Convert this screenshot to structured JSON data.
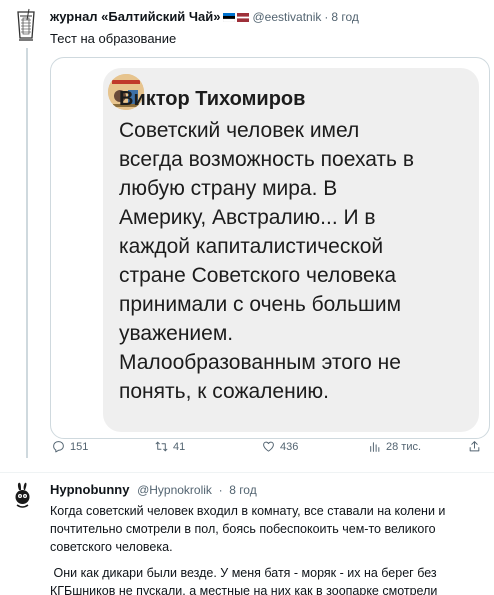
{
  "tweet1": {
    "author_name": "журнал «Балтийский Чай»",
    "handle": "@eestivatnik",
    "separator": "·",
    "time": "8 год",
    "text": "Тест на образование",
    "quote": {
      "author": "Виктор Тихомиров",
      "lines": [
        "Советский человек имел",
        "всегда возможность поехать в",
        "любую страну мира. В",
        "Америку, Австралию... И в",
        "каждой капиталистической",
        "стране Советского человека",
        "принимали с очень большим",
        "уважением.",
        "Малообразованным этого не",
        "понять, к сожалению."
      ]
    },
    "actions": {
      "replies": "151",
      "retweets": "41",
      "likes": "436",
      "views": "28 тис."
    }
  },
  "tweet2": {
    "author_name": "Hypnobunny",
    "handle": "@Hypnokrolik",
    "separator": "·",
    "time": "8 год",
    "paragraph1": "Когда советский человек входил в комнату, все ставали на колени и почтительно смотрели в пол, боясь побеспокоить чем-то великого советского человека.",
    "paragraph2": " Они как дикари были везде. У меня батя - моряк - их на берег без КГБшников не пускали, а местные на них как в зоопарке смотрели"
  },
  "colors": {
    "text": "#0f1419",
    "secondary": "#536471",
    "border": "#cfd9de",
    "quote_bg": "#efefef"
  }
}
